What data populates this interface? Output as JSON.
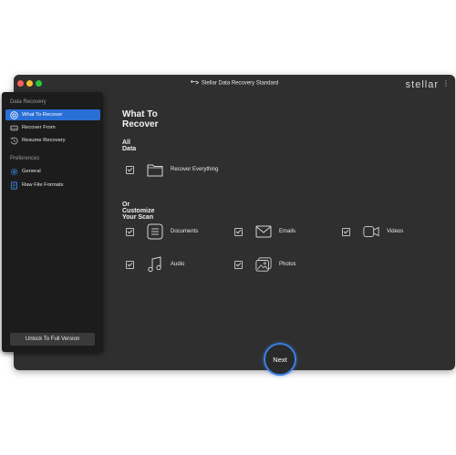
{
  "window": {
    "title": "Stellar Data Recovery Standard",
    "brand": "stellar",
    "menu_icon": "kebab-menu-icon"
  },
  "sidebar": {
    "sections": [
      {
        "label": "Data Recovery",
        "items": [
          {
            "label": "What To Recover",
            "icon": "target-icon",
            "active": true
          },
          {
            "label": "Recover From",
            "icon": "drive-icon",
            "active": false
          },
          {
            "label": "Resume Recovery",
            "icon": "history-icon",
            "active": false
          }
        ]
      },
      {
        "label": "Preferences",
        "items": [
          {
            "label": "General",
            "icon": "gear-icon",
            "active": false
          },
          {
            "label": "Raw File Formats",
            "icon": "file-list-icon",
            "active": false
          }
        ]
      }
    ],
    "unlock_label": "Unlock To Full Version"
  },
  "main": {
    "title": "What To Recover",
    "all_data": {
      "heading": "All Data",
      "recover_everything": {
        "label": "Recover Everything",
        "checked": true,
        "icon": "folder-icon"
      }
    },
    "customize": {
      "heading": "Or Customize Your Scan",
      "options": [
        {
          "label": "Documents",
          "checked": true,
          "icon": "document-icon"
        },
        {
          "label": "Emails",
          "checked": true,
          "icon": "mail-icon"
        },
        {
          "label": "Videos",
          "checked": true,
          "icon": "video-icon"
        },
        {
          "label": "Audio",
          "checked": true,
          "icon": "music-icon"
        },
        {
          "label": "Photos",
          "checked": true,
          "icon": "photo-icon"
        }
      ]
    },
    "next_label": "Next"
  },
  "colors": {
    "accent": "#2a6fd6",
    "window_bg": "#2f2f2f",
    "sidebar_bg": "#1c1c1c",
    "next_ring": "#3b7fe0"
  }
}
